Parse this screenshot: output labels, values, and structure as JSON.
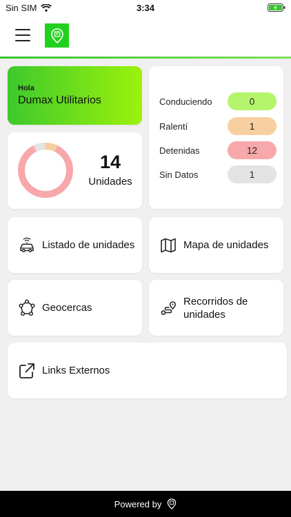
{
  "status_bar": {
    "carrier": "Sin SIM",
    "time": "3:34",
    "icons": [
      "wifi-icon",
      "battery-charging-icon"
    ]
  },
  "app_bar": {
    "menu_icon": "hamburger-menu-icon",
    "logo_icon": "app-logo-icon",
    "logo_color": "#22d11f"
  },
  "greeting": {
    "hello": "Hola",
    "client_name": "Dumax Utilitarios"
  },
  "units_summary": {
    "count": "14",
    "label": "Unidades"
  },
  "status": [
    {
      "label": "Conduciendo",
      "value": "0",
      "color": "#b5f56b"
    },
    {
      "label": "Ralentí",
      "value": "1",
      "color": "#f8cfa0"
    },
    {
      "label": "Detenidas",
      "value": "12",
      "color": "#f7a8aa"
    },
    {
      "label": "Sin Datos",
      "value": "1",
      "color": "#e3e3e3"
    }
  ],
  "menu": {
    "units_list": {
      "label": "Listado de unidades",
      "icon": "car-signal-icon"
    },
    "units_map": {
      "label": "Mapa de unidades",
      "icon": "map-icon"
    },
    "geofences": {
      "label": "Geocercas",
      "icon": "geofence-polygon-icon"
    },
    "routes": {
      "label": "Recorridos de unidades",
      "icon": "route-icon"
    },
    "external_links": {
      "label": "Links Externos",
      "icon": "external-link-icon"
    }
  },
  "footer": {
    "powered_by": "Powered by",
    "icon": "brand-logo-icon"
  },
  "colors": {
    "accent_green": "#3ec92c",
    "accent_lime": "#9cf20c",
    "background": "#f0f0f0"
  }
}
